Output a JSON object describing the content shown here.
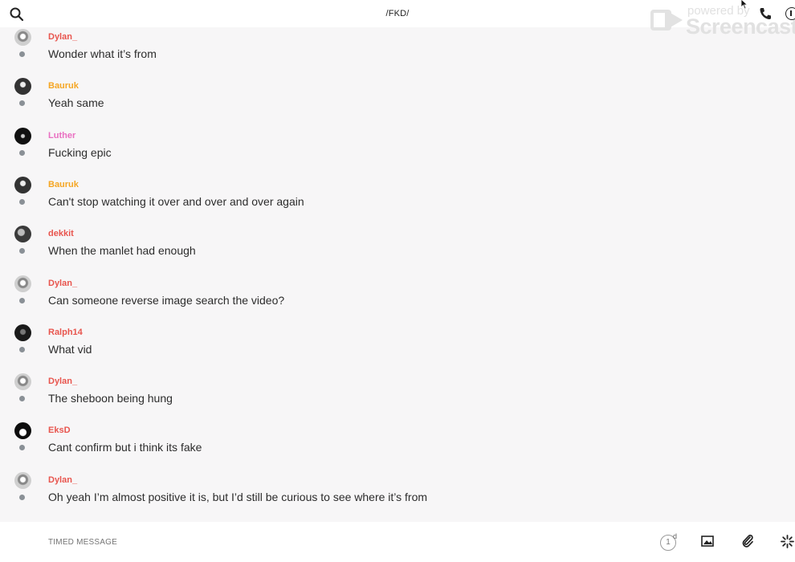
{
  "header": {
    "title": "/FKD/",
    "search_icon": "search-icon",
    "phone_icon": "phone-icon",
    "info_icon": "info-icon"
  },
  "watermark": {
    "powered": "powered by",
    "brand": "Screencastify"
  },
  "colors": {
    "dylan": "#e8554e",
    "bauruk": "#f5a623",
    "luther": "#e96fc1",
    "red_user": "#e8554e",
    "status_dot": "#8a9096"
  },
  "messages": [
    {
      "user": "Dylan_",
      "text": "Wonder what it’s from",
      "color": "#e8554e"
    },
    {
      "user": "Bauruk",
      "text": "Yeah same",
      "color": "#f5a623"
    },
    {
      "user": "Luther",
      "text": "Fucking epic",
      "color": "#e96fc1"
    },
    {
      "user": "Bauruk",
      "text": "Can't stop watching it over and over and over again",
      "color": "#f5a623"
    },
    {
      "user": "dekkit",
      "text": "When the manlet had enough",
      "color": "#e8554e"
    },
    {
      "user": "Dylan_",
      "text": "Can someone reverse image search the video?",
      "color": "#e8554e"
    },
    {
      "user": "Ralph14",
      "text": "What vid",
      "color": "#e8554e"
    },
    {
      "user": "Dylan_",
      "text": "The sheboon being hung",
      "color": "#e8554e"
    },
    {
      "user": "EksD",
      "text": "Cant confirm but i think its fake",
      "color": "#e8554e"
    },
    {
      "user": "Dylan_",
      "text": "Oh yeah I’m almost positive it is, but I’d still be curious to see where it’s from",
      "color": "#e8554e"
    }
  ],
  "composer": {
    "placeholder": "TIMED MESSAGE",
    "timer_value": "1",
    "timer_unit": "d",
    "image_icon": "image-icon",
    "attach_icon": "paperclip-icon",
    "effects_icon": "sparkle-icon"
  }
}
